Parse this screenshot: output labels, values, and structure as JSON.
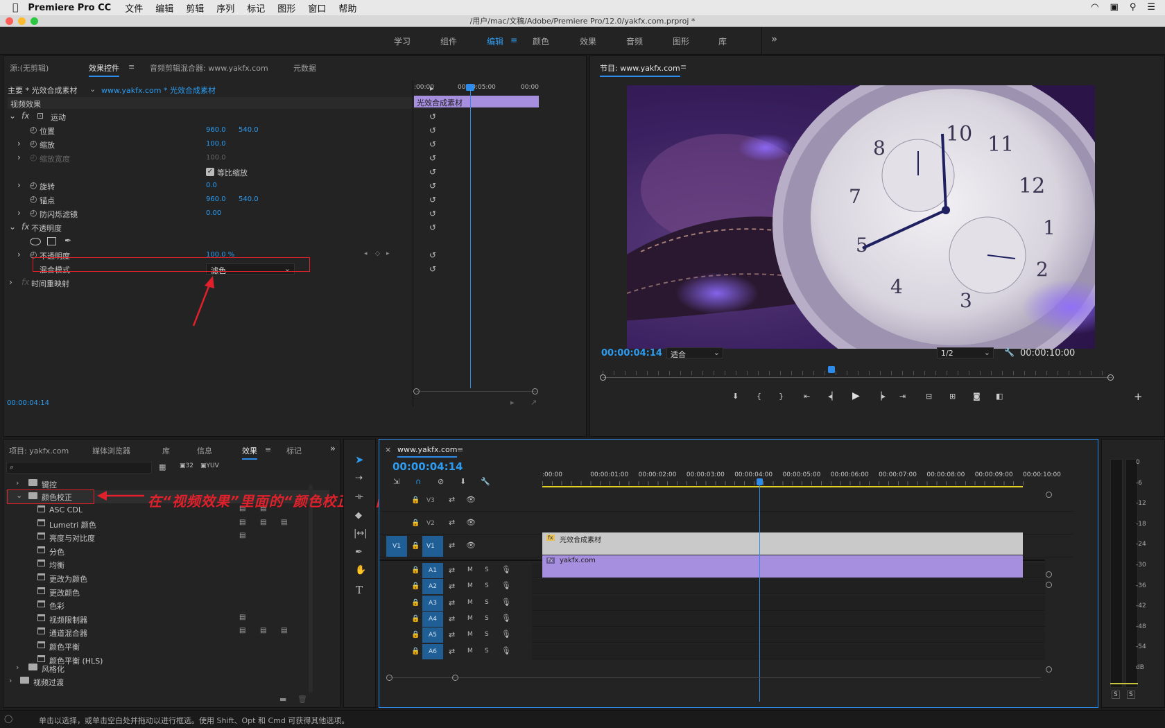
{
  "menubar": {
    "app": "Premiere Pro CC",
    "items": [
      "文件",
      "编辑",
      "剪辑",
      "序列",
      "标记",
      "图形",
      "窗口",
      "帮助"
    ]
  },
  "titlebar": {
    "path": "/用户/mac/文稿/Adobe/Premiere Pro/12.0/yakfx.com.prproj *"
  },
  "workspace": {
    "tabs": [
      "学习",
      "组件",
      "编辑",
      "颜色",
      "效果",
      "音频",
      "图形",
      "库"
    ],
    "active": "编辑",
    "more": "»"
  },
  "source_panel": {
    "tabs": [
      "源:(无剪辑)",
      "效果控件",
      "音频剪辑混合器: www.yakfx.com",
      "元数据"
    ],
    "master": "主要 * 光效合成素材",
    "clip": "www.yakfx.com * 光效合成素材",
    "section": "视频效果",
    "ruler": [
      ":00:00",
      "00:00:05:00",
      "00:00"
    ],
    "clip_bar": "光效合成素材",
    "timecode": "00:00:04:14",
    "rows": {
      "motion": "运动",
      "position": {
        "label": "位置",
        "v1": "960.0",
        "v2": "540.0"
      },
      "scale": {
        "label": "缩放",
        "v1": "100.0"
      },
      "scale_width": {
        "label": "缩放宽度",
        "v1": "100.0"
      },
      "uniform": "等比缩放",
      "rotation": {
        "label": "旋转",
        "v1": "0.0"
      },
      "anchor": {
        "label": "锚点",
        "v1": "960.0",
        "v2": "540.0"
      },
      "flicker": {
        "label": "防闪烁滤镜",
        "v1": "0.00"
      },
      "opacity_group": "不透明度",
      "opacity": {
        "label": "不透明度",
        "v1": "100.0 %"
      },
      "blend": {
        "label": "混合模式",
        "value": "滤色"
      },
      "time_remap": "时间重映射"
    }
  },
  "program": {
    "title": "节目: www.yakfx.com",
    "timecode": "00:00:04:14",
    "fit": "适合",
    "quality": "1/2",
    "duration": "00:00:10:00"
  },
  "project_panel": {
    "tabs": [
      "项目: yakfx.com",
      "媒体浏览器",
      "库",
      "信息",
      "效果",
      "标记"
    ],
    "folders": [
      {
        "name": "键控",
        "open": false,
        "indent": 0
      },
      {
        "name": "颜色校正",
        "open": true,
        "indent": 0
      }
    ],
    "items": [
      "ASC CDL",
      "Lumetri 颜色",
      "亮度与对比度",
      "分色",
      "均衡",
      "更改为颜色",
      "更改颜色",
      "色彩",
      "视频限制器",
      "通道混合器",
      "颜色平衡",
      "颜色平衡 (HLS)"
    ],
    "after": [
      "风格化",
      "视频过渡"
    ]
  },
  "annotation": "在“视频效果”里面的“颜色校正”里面可添加修改颜色、亮度、对比度等",
  "timeline": {
    "title": "www.yakfx.com",
    "timecode": "00:00:04:14",
    "ruler": [
      ":00:00",
      "00:00:01:00",
      "00:00:02:00",
      "00:00:03:00",
      "00:00:04:00",
      "00:00:05:00",
      "00:00:06:00",
      "00:00:07:00",
      "00:00:08:00",
      "00:00:09:00",
      "00:00:10:00"
    ],
    "video_tracks": [
      "V3",
      "V2",
      "V1"
    ],
    "audio_tracks": [
      "A1",
      "A2",
      "A3",
      "A4",
      "A5",
      "A6"
    ],
    "source_patch": "V1",
    "clip_v2": "光效合成素材",
    "clip_v1": "yakfx.com",
    "m": "M",
    "s": "S"
  },
  "vu": {
    "labels": [
      "0",
      "-6",
      "-12",
      "-18",
      "-24",
      "-30",
      "-36",
      "-42",
      "-48",
      "-54",
      "dB"
    ],
    "solo": "S"
  },
  "statusbar": "单击以选择，或单击空白处并拖动以进行框选。使用 Shift、Opt 和 Cmd 可获得其他选项。",
  "colors": {
    "accent": "#2d8ceb",
    "clip_purple": "#a78fdf",
    "annotation": "#e0202a"
  }
}
